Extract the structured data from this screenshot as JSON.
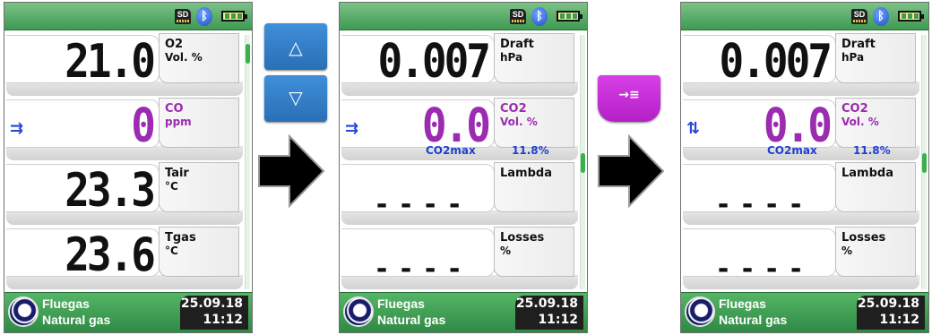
{
  "status": {
    "sd_label": "SD",
    "bluetooth_icon": "bluetooth-icon",
    "battery_icon": "battery-icon"
  },
  "footer": {
    "mode": "Fluegas",
    "fuel": "Natural gas",
    "date": "25.09.18",
    "time": "11:12"
  },
  "screens": [
    {
      "rows": [
        {
          "value": "21.0",
          "label": "O2",
          "unit": "Vol. %"
        },
        {
          "value": "0",
          "label": "CO",
          "unit": "ppm",
          "purple": true,
          "icon": "⇉"
        },
        {
          "value": "23.3",
          "label": "Tair",
          "unit": "°C"
        },
        {
          "value": "23.6",
          "label": "Tgas",
          "unit": "°C"
        }
      ]
    },
    {
      "rows": [
        {
          "value": "0.007",
          "label": "Draft",
          "unit": "hPa"
        },
        {
          "value": "0.0",
          "label": "CO2",
          "unit": "Vol. %",
          "purple": true,
          "icon": "⇉",
          "sub_label": "CO2max",
          "sub_value": "11.8%"
        },
        {
          "dashes": "----",
          "label": "Lambda",
          "unit": ""
        },
        {
          "dashes": "----",
          "label": "Losses",
          "unit": "%"
        }
      ]
    },
    {
      "rows": [
        {
          "value": "0.007",
          "label": "Draft",
          "unit": "hPa"
        },
        {
          "value": "0.0",
          "label": "CO2",
          "unit": "Vol. %",
          "purple": true,
          "icon": "⇅",
          "sub_label": "CO2max",
          "sub_value": "11.8%"
        },
        {
          "dashes": "----",
          "label": "Lambda",
          "unit": ""
        },
        {
          "dashes": "----",
          "label": "Losses",
          "unit": "%"
        }
      ]
    }
  ],
  "keys": {
    "up": "△",
    "down": "▽",
    "enter": "→≡"
  }
}
